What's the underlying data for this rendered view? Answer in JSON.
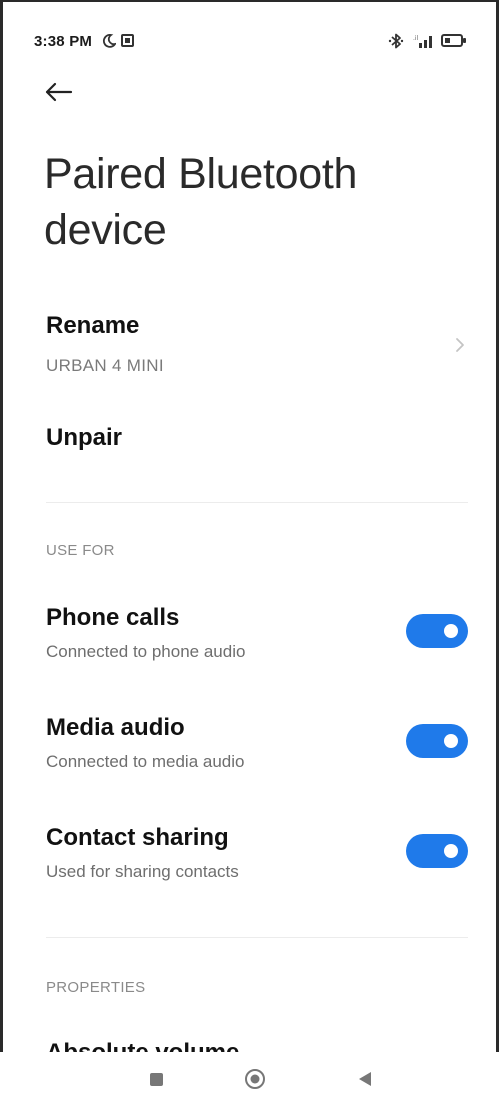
{
  "status_bar": {
    "time": "3:38 PM"
  },
  "page": {
    "title": "Paired Bluetooth device"
  },
  "device": {
    "rename_label": "Rename",
    "name": "URBAN 4 MINI",
    "unpair_label": "Unpair"
  },
  "use_for": {
    "header": "USE FOR",
    "items": [
      {
        "title": "Phone calls",
        "subtitle": "Connected to phone audio",
        "enabled": true
      },
      {
        "title": "Media audio",
        "subtitle": "Connected to media audio",
        "enabled": true
      },
      {
        "title": "Contact sharing",
        "subtitle": "Used for sharing contacts",
        "enabled": true
      }
    ]
  },
  "properties": {
    "header": "PROPERTIES",
    "first_item": "Absolute volume"
  },
  "colors": {
    "toggle_on": "#1f7aea",
    "background": "#ffffff"
  },
  "icons": [
    "moon-icon",
    "notification-icon",
    "bluetooth-icon",
    "signal-icon",
    "battery-icon",
    "back-arrow-icon",
    "chevron-right-icon",
    "recents-icon",
    "home-icon",
    "back-icon"
  ]
}
